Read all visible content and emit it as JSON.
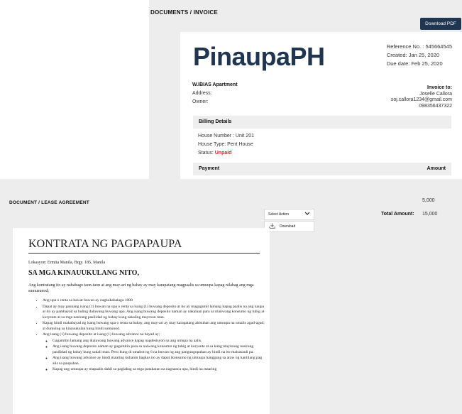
{
  "invoice": {
    "breadcrumb": "DOCUMENTS / INVOICE",
    "download_pdf": "Download PDF",
    "brand": "PinaupaPH",
    "reference": "Reference No. : 545664545",
    "created": "Created: Jan 25, 2020",
    "due": "Due date: Feb 25, 2020",
    "apartment_name": "W.IBIAS Apartment",
    "address_label": "Address:",
    "owner_label": "Owner:",
    "invoice_to_title": "Invoice to:",
    "invoice_to_name": "Joselle Callora",
    "invoice_to_email": "soj.callora1234@gmail.com",
    "invoice_to_phone": "098356437322",
    "billing_title": "Billing Details",
    "house_number": "House  Number : Unit 201",
    "house_type": "House Type: Pent House",
    "status_label": "Status: ",
    "status_value": "Unpaid",
    "payment_label": "Payment",
    "amount_label": "Amount",
    "amount_value": "5,000",
    "total_label": "Total Amount:",
    "total_value": "15,000",
    "colors": {
      "brand": "#1f3550",
      "unpaid": "#d9262b"
    }
  },
  "lease": {
    "breadcrumb": "DOCUMENT / LEASE AGREEMENT",
    "select_action": "Select Action",
    "download": "Download",
    "title": "KONTRATA NG PAGPAPAUPA",
    "location": "Lokasyon: Ermita Manila, Brgy. 185, Manila",
    "subheading": "SA MGA KINAUUKULANG NITO,",
    "intro": "Ang kontratang ito ay nababago taon-taon at ang may-ari ng bahay ay may karapatang magpaalis sa umuupa kapag nilabag ang mga sumusunod;",
    "items": [
      "Ang upa o renta sa bawat buwan ay nagkakahalaga 1000",
      "Dapat ay may paunang isang (1) buwan na upa o renta sa isang (1) buwang deposito at ito ay magagamit lamang kapag paalis na ang naupa at ito ay pambayad sa huling dalawang buwang upa. Ang isang buwang deposito naman ay nakalaan para sa maiiwang konsumo ng tubig at kuryente at sa mga nasirang pasilidad ng bahay kung sakaling mayroon man.",
      "Kapag hindi makabayad ng isang buwang upa o renta sa bahay, ang may-ari ay may karapatang abisuhan ang umuupa na umalis agad-agad; at dumulog sa kinauukulan kung hindi sumunod.",
      "Ang isang (1) buwang deposito at isang (1) buwang advance na bayad ay;"
    ],
    "subitems": [
      "Gagamitin lamang ang ikalawang buwang advance kapag nagdesisyon na ang umupa na aalis.",
      "Ang isang buwang deposito naman ay gagamitin para sa naiwang konsumo ng tubig at kuryente at sa kung mayroong nasirang pasilidad ng bahay kung sakali man. Pero kung di umabot ng 6 na buwan ng ang pangungupahan ay hindi na ito maisasauli pa.",
      "Ang isang buwang advance ay hindi maaring kuhanin bagkus ito ay dapat ikonsumo ng umuupa hanggang sa araw ng kaniliang pag alis sa paupahan.",
      "Kapag ang umuupa ay mapaalis dahil sa paglabag sa mga patakaran na nagnanca upa, hindi na maaring"
    ]
  }
}
